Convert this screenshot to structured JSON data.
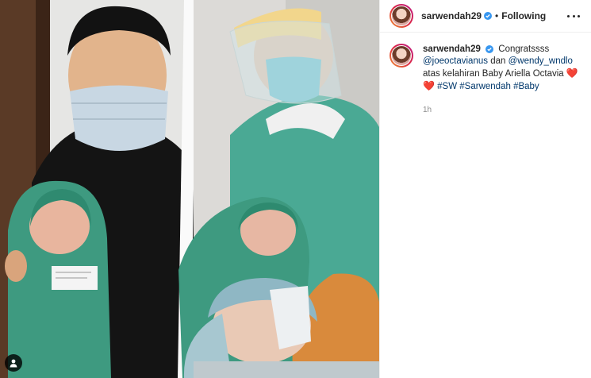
{
  "post": {
    "username": "sarwendah29",
    "follow_status": "Following",
    "caption": {
      "username": "sarwendah29",
      "text_1": "Congratssss",
      "mention_1": "@joeoctavianus",
      "text_2": "dan",
      "mention_2": "@wendy_wndlo",
      "text_3": "atas kelahiran Baby Ariella Octavia",
      "hashtag_1": "#SW",
      "hashtag_2": "#Sarwendah",
      "hashtag_3": "#Baby",
      "heart_1": "❤️",
      "heart_2": "❤️"
    },
    "timestamp": "1h"
  },
  "colors": {
    "link": "#00376b",
    "verified": "#3897f0",
    "heart": "#d01f2b"
  },
  "icons": [
    "verified-badge-icon",
    "more-options-icon",
    "user-tag-icon",
    "heart-emoji-icon"
  ]
}
